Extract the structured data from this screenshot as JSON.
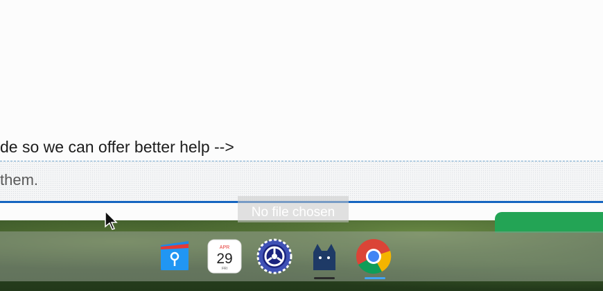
{
  "page": {
    "comment_text": "de so we can offer better help -->",
    "textarea_text": "them.",
    "file_input_status": "No file chosen"
  },
  "shelf": {
    "apps": [
      {
        "name": "Files",
        "icon": "files-app-icon"
      },
      {
        "name": "Calendar",
        "icon": "calendar-app-icon",
        "month": "APR",
        "day": "29",
        "weekday": "FRI"
      },
      {
        "name": "Settings",
        "icon": "settings-gear-app-icon"
      },
      {
        "name": "Cat",
        "icon": "cat-app-icon"
      },
      {
        "name": "Chrome",
        "icon": "chrome-app-icon"
      }
    ]
  },
  "colors": {
    "focus": "#1565c0",
    "action_button": "#23a455"
  }
}
